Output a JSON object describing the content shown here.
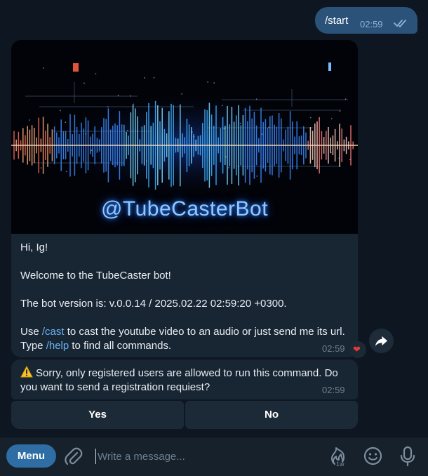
{
  "outgoing": {
    "text": "/start",
    "time": "02:59"
  },
  "bot_message": {
    "banner_handle": "@TubeCasterBot",
    "greeting": "Hi, Ig!",
    "welcome": "Welcome to the TubeCaster bot!",
    "version": "The bot version is: v.0.0.14 / 2025.02.22 02:59:20 +0300.",
    "usage_pre": "Use ",
    "cmd_cast": "/cast",
    "usage_mid": " to cast the youtube video to an audio or just send me its url. Type ",
    "cmd_help": "/help",
    "usage_post": " to find all commands.",
    "time": "02:59",
    "reaction": "❤"
  },
  "warning_message": {
    "text": "Sorry, only registered users are allowed to run this command. Do you want to send a registration requiest?",
    "time": "02:59"
  },
  "keyboard": {
    "yes": "Yes",
    "no": "No"
  },
  "input_bar": {
    "menu_label": "Menu",
    "placeholder": "Write a message...",
    "timer_label": "1w"
  },
  "colors": {
    "accent": "#2f6ea5",
    "outgoing_bubble": "#2b5278",
    "incoming_bubble": "#182533",
    "link": "#6ab3f3"
  }
}
